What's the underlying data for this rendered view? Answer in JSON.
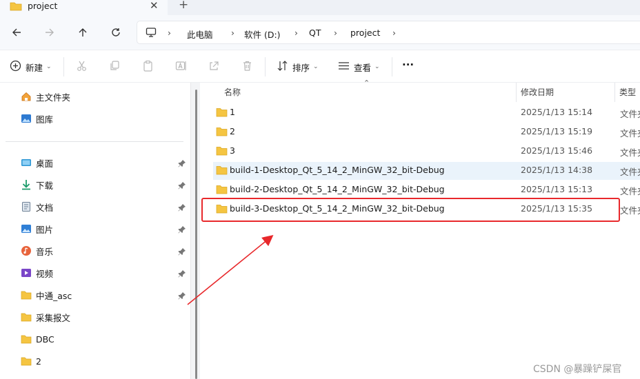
{
  "window": {
    "tab_title": "project",
    "close_glyph": "✕",
    "new_tab_glyph": "+"
  },
  "breadcrumb": {
    "items": [
      "此电脑",
      "软件 (D:)",
      "QT",
      "project"
    ],
    "separator": "›"
  },
  "toolbar": {
    "new_label": "新建",
    "sort_label": "排序",
    "view_label": "查看",
    "more_label": "···"
  },
  "sidebar": {
    "quick": [
      {
        "label": "主文件夹",
        "icon": "home-icon"
      },
      {
        "label": "图库",
        "icon": "gallery-icon"
      }
    ],
    "items": [
      {
        "label": "桌面",
        "icon": "desktop-icon",
        "pinned": true
      },
      {
        "label": "下载",
        "icon": "download-icon",
        "pinned": true
      },
      {
        "label": "文档",
        "icon": "document-icon",
        "pinned": true
      },
      {
        "label": "图片",
        "icon": "pictures-icon",
        "pinned": true
      },
      {
        "label": "音乐",
        "icon": "music-icon",
        "pinned": true
      },
      {
        "label": "视频",
        "icon": "video-icon",
        "pinned": true
      },
      {
        "label": "中通_asc",
        "icon": "folder-icon",
        "pinned": true
      },
      {
        "label": "采集报文",
        "icon": "folder-icon",
        "pinned": false
      },
      {
        "label": "DBC",
        "icon": "folder-icon",
        "pinned": false
      },
      {
        "label": "2",
        "icon": "folder-icon",
        "pinned": false
      }
    ]
  },
  "file_list": {
    "columns": {
      "name": "名称",
      "modified": "修改日期",
      "type": "类型"
    },
    "rows": [
      {
        "name": "1",
        "modified": "2025/1/13 15:14",
        "type": "文件夹"
      },
      {
        "name": "2",
        "modified": "2025/1/13 15:19",
        "type": "文件夹"
      },
      {
        "name": "3",
        "modified": "2025/1/13 15:46",
        "type": "文件夹"
      },
      {
        "name": "build-1-Desktop_Qt_5_14_2_MinGW_32_bit-Debug",
        "modified": "2025/1/13 14:38",
        "type": "文件夹",
        "selected": true
      },
      {
        "name": "build-2-Desktop_Qt_5_14_2_MinGW_32_bit-Debug",
        "modified": "2025/1/13 15:13",
        "type": "文件夹"
      },
      {
        "name": "build-3-Desktop_Qt_5_14_2_MinGW_32_bit-Debug",
        "modified": "2025/1/13 15:35",
        "type": "文件夹",
        "highlighted": true
      }
    ]
  },
  "watermark": "CSDN @暴躁铲屎官",
  "colors": {
    "folder": "#f5c542",
    "annotation": "#e8282b",
    "selection": "#eaf3fb"
  }
}
